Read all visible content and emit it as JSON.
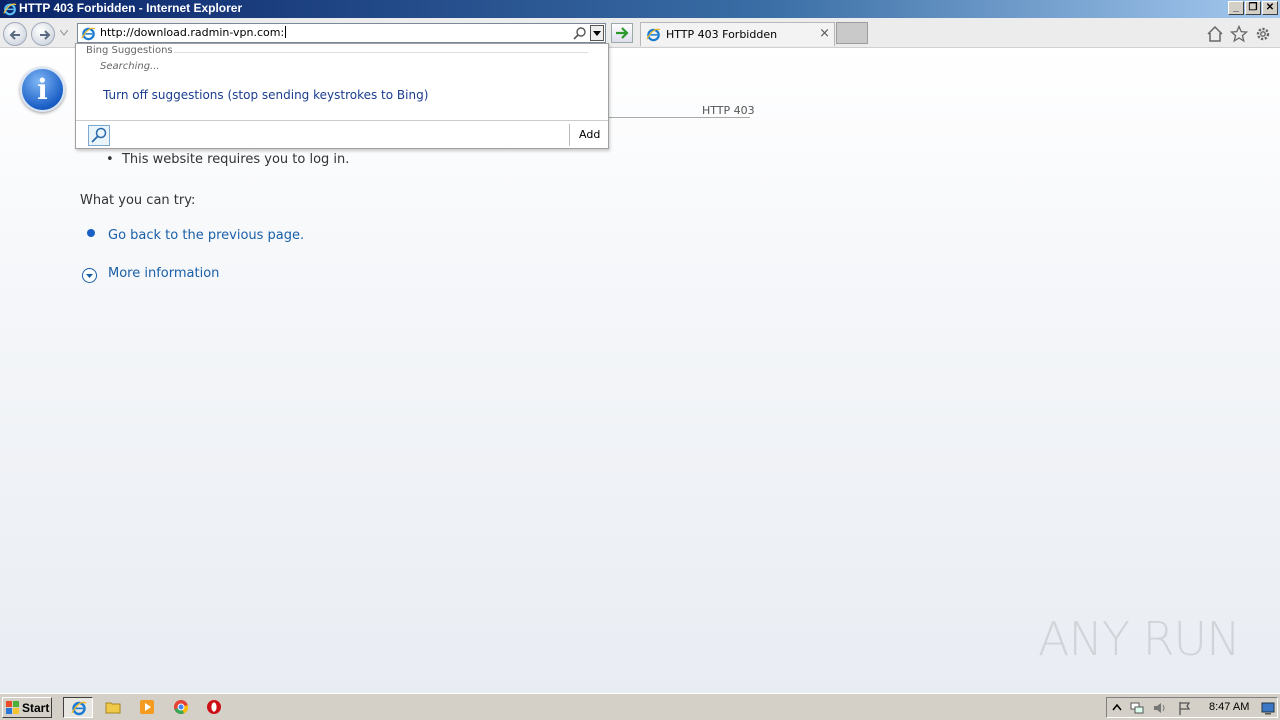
{
  "window": {
    "title": "HTTP 403 Forbidden - Internet Explorer"
  },
  "address_bar": {
    "url": "http://download.radmin-vpn.com:"
  },
  "tab": {
    "label": "HTTP 403 Forbidden"
  },
  "suggestions": {
    "header": "Bing Suggestions",
    "status": "Searching...",
    "turn_off_label": "Turn off suggestions (stop sending keystrokes to Bing)",
    "add_label": "Add"
  },
  "page": {
    "code": "HTTP 403",
    "bullet": "This website requires you to log in.",
    "try_heading": "What you can try:",
    "back_link": "Go back to the previous page.",
    "more_info": "More information"
  },
  "watermark": "ANY RUN",
  "taskbar": {
    "start_label": "Start",
    "clock": "8:47 AM"
  },
  "colors": {
    "link": "#1a5fa8",
    "accent": "#1a5fc6"
  }
}
